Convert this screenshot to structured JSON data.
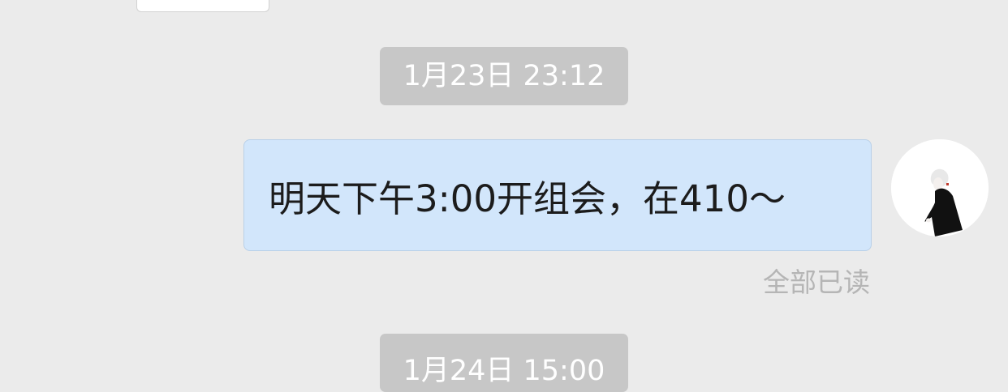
{
  "chat": {
    "timestamps": {
      "first": "1月23日 23:12",
      "next": "1月24日 15:00"
    },
    "message": {
      "text": "明天下午3:00开组会，在410～",
      "read_status": "全部已读"
    },
    "colors": {
      "background": "#ebebeb",
      "sent_bubble": "#d2e6fb",
      "time_pill": "#c7c7c7",
      "read_status": "#b5b5b5"
    },
    "icons": {
      "avatar": "user-avatar"
    }
  }
}
